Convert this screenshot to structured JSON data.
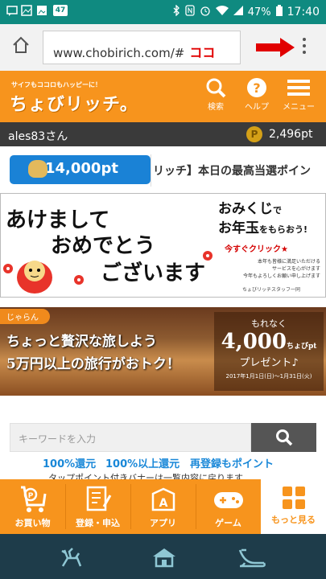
{
  "status_bar": {
    "badge": "47",
    "battery": "47%",
    "time": "17:40"
  },
  "browser": {
    "url": "www.chobirich.com/#",
    "annotation": "ココ"
  },
  "header": {
    "tagline": "サイフもココロもハッピーに！",
    "logo": "ちょびリッチ。",
    "search_label": "検索",
    "help_label": "ヘルプ",
    "menu_label": "メニュー"
  },
  "user": {
    "name": "ales83さん",
    "coin": "P",
    "points": "2,496pt"
  },
  "balance": {
    "value": "14,000pt",
    "ticker": "リッチ】本日の最高当選ポイン"
  },
  "newyear_banner": {
    "line1": "あけまして",
    "line2": "おめでとう",
    "line3": "ございます",
    "promo_a": "おみくじ",
    "promo_a_suffix": "で",
    "promo_b": "お年玉",
    "promo_b_suffix": "をもらおう!",
    "click": "今すぐクリック★",
    "fine1": "本年も皆様に満足いただける",
    "fine2": "サービスを心がけます",
    "fine3": "今年もよろしくお願い申し上げます",
    "staff": "ちょびリッチスタッフ一同"
  },
  "travel_banner": {
    "tag": "じゃらん",
    "line1": "ちょっと贅沢な旅しよう",
    "line2": "5万円以上の旅行がおトク！",
    "offer_a": "もれなく",
    "offer_value": "4,000",
    "offer_unit": "ちょびpt",
    "offer_c": "プレゼント♪",
    "period": "2017年1月1日(日)〜1月31日(火)"
  },
  "search": {
    "placeholder": "キーワードを入力"
  },
  "links": {
    "l1": "100%還元",
    "l2": "100%以上還元",
    "l3": "再登録もポイント",
    "partial": "タップポイント付きバナーは一覧内容に戻ります"
  },
  "tabs": {
    "shopping": "お買い物",
    "register": "登録・申込",
    "app": "アプリ",
    "game": "ゲーム",
    "more": "もっと見る"
  },
  "colors": {
    "orange": "#f7941d",
    "teal": "#0f8a80",
    "blue": "#1a82d6",
    "navbar": "#1e3c4a"
  }
}
